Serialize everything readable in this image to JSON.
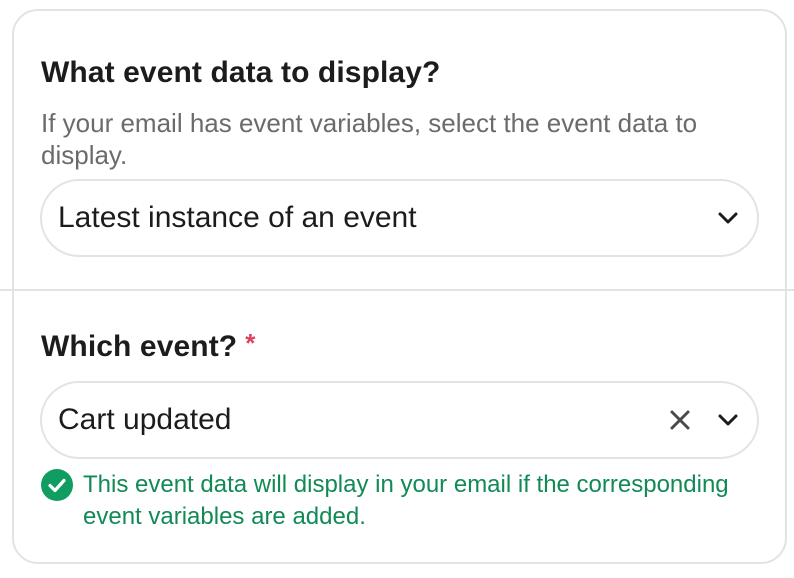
{
  "section_display": {
    "heading": "What event data to display?",
    "helper": "If your email has event variables, select the event data to display.",
    "select_value": "Latest instance of an event"
  },
  "section_event": {
    "heading": "Which event?",
    "required_marker": "*",
    "select_value": "Cart updated",
    "success_message": "This event data will display in your email if the corresponding event variables are added."
  },
  "icons": {
    "dropdown": "chevron-down-icon",
    "clear": "close-icon",
    "success": "check-circle-icon"
  },
  "colors": {
    "border": "#e3e3e3",
    "heading": "#1c1c1c",
    "helper": "#6b6b6b",
    "required": "#e0415a",
    "success": "#118a56",
    "success_icon": "#0f9d62"
  }
}
